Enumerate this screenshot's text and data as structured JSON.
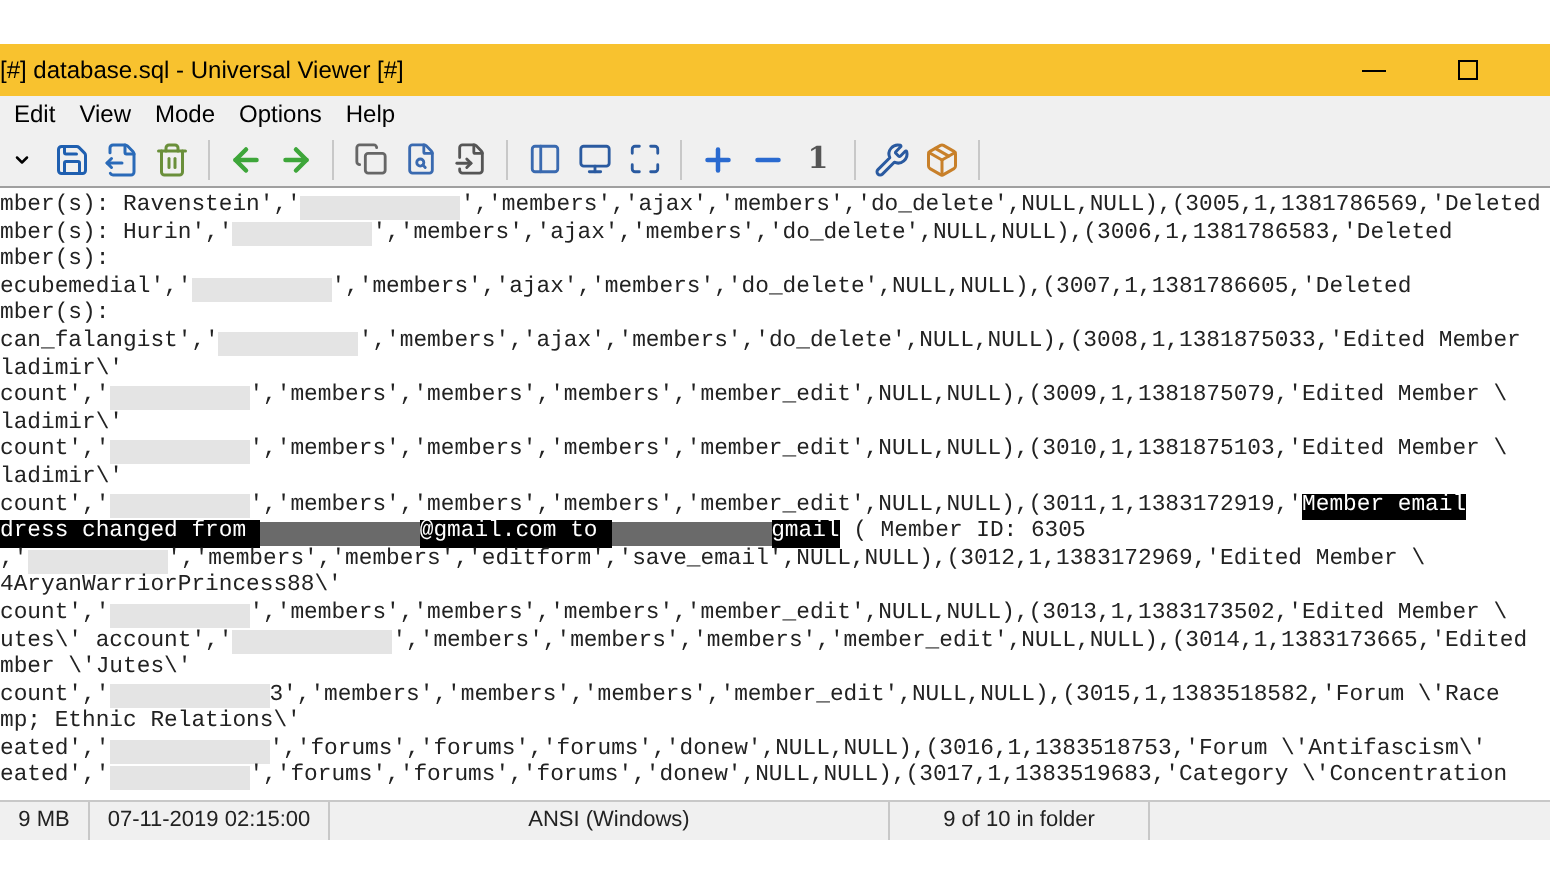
{
  "window": {
    "title": "[#] database.sql - Universal Viewer [#]"
  },
  "menu": [
    "Edit",
    "View",
    "Mode",
    "Options",
    "Help"
  ],
  "toolbar": {
    "actual_size_label": "1"
  },
  "lines": [
    [
      {
        "kind": "text",
        "text": "mber(s): Ravenstein','",
        "highlighted": false
      },
      {
        "kind": "redacted",
        "highlighted": false
      },
      {
        "kind": "text",
        "text": "','members','ajax','members','do_delete',NULL,NULL),(3005,1,1381786569,'Deleted",
        "highlighted": false
      }
    ],
    [
      {
        "kind": "text",
        "text": "mber(s): Hurin','",
        "highlighted": false
      },
      {
        "kind": "redacted",
        "highlighted": false
      },
      {
        "kind": "text",
        "text": "','members','ajax','members','do_delete',NULL,NULL),(3006,1,1381786583,'Deleted",
        "highlighted": false
      }
    ],
    [
      {
        "kind": "text",
        "text": "mber(s):",
        "highlighted": false
      }
    ],
    [
      {
        "kind": "text",
        "text": "ecubemedial','",
        "highlighted": false
      },
      {
        "kind": "redacted",
        "highlighted": false
      },
      {
        "kind": "text",
        "text": "','members','ajax','members','do_delete',NULL,NULL),(3007,1,1381786605,'Deleted",
        "highlighted": false
      }
    ],
    [
      {
        "kind": "text",
        "text": "mber(s):",
        "highlighted": false
      }
    ],
    [
      {
        "kind": "text",
        "text": "can_falangist','",
        "highlighted": false
      },
      {
        "kind": "redacted",
        "highlighted": false
      },
      {
        "kind": "text",
        "text": "','members','ajax','members','do_delete',NULL,NULL),(3008,1,1381875033,'Edited Member",
        "highlighted": false
      }
    ],
    [
      {
        "kind": "text",
        "text": "ladimir\\'",
        "highlighted": false
      }
    ],
    [
      {
        "kind": "text",
        "text": "count','",
        "highlighted": false
      },
      {
        "kind": "redacted",
        "highlighted": false
      },
      {
        "kind": "text",
        "text": "','members','members','members','member_edit',NULL,NULL),(3009,1,1381875079,'Edited Member \\",
        "highlighted": false
      }
    ],
    [
      {
        "kind": "text",
        "text": "ladimir\\'",
        "highlighted": false
      }
    ],
    [
      {
        "kind": "text",
        "text": "count','",
        "highlighted": false
      },
      {
        "kind": "redacted",
        "highlighted": false
      },
      {
        "kind": "text",
        "text": "','members','members','members','member_edit',NULL,NULL),(3010,1,1381875103,'Edited Member \\",
        "highlighted": false
      }
    ],
    [
      {
        "kind": "text",
        "text": "ladimir\\'",
        "highlighted": false
      }
    ],
    [
      {
        "kind": "text",
        "text": "count','",
        "highlighted": false
      },
      {
        "kind": "redacted",
        "highlighted": false
      },
      {
        "kind": "text",
        "text": "','members','members','members','member_edit',NULL,NULL),(3011,1,1383172919,'",
        "highlighted": false
      },
      {
        "kind": "text",
        "text": "Member email",
        "highlighted": true
      }
    ],
    [
      {
        "kind": "text",
        "text": "dress changed from ",
        "highlighted": true
      },
      {
        "kind": "redacted",
        "highlighted": true
      },
      {
        "kind": "text",
        "text": "@gmail.com to ",
        "highlighted": true
      },
      {
        "kind": "redacted",
        "highlighted": true
      },
      {
        "kind": "text",
        "text": "gmail",
        "highlighted": true
      },
      {
        "kind": "text",
        "text": " ( Member ID: 6305",
        "highlighted": false
      }
    ],
    [
      {
        "kind": "text",
        "text": ",'",
        "highlighted": false
      },
      {
        "kind": "redacted",
        "highlighted": false
      },
      {
        "kind": "text",
        "text": "','members','members','editform','save_email',NULL,NULL),(3012,1,1383172969,'Edited Member \\",
        "highlighted": false
      }
    ],
    [
      {
        "kind": "text",
        "text": "4AryanWarriorPrincess88\\'",
        "highlighted": false
      }
    ],
    [
      {
        "kind": "text",
        "text": "count','",
        "highlighted": false
      },
      {
        "kind": "redacted",
        "highlighted": false
      },
      {
        "kind": "text",
        "text": "','members','members','members','member_edit',NULL,NULL),(3013,1,1383173502,'Edited Member \\",
        "highlighted": false
      }
    ],
    [
      {
        "kind": "text",
        "text": "utes\\' account','",
        "highlighted": false
      },
      {
        "kind": "redacted",
        "highlighted": false
      },
      {
        "kind": "text",
        "text": "','members','members','members','member_edit',NULL,NULL),(3014,1,1383173665,'Edited",
        "highlighted": false
      }
    ],
    [
      {
        "kind": "text",
        "text": "mber \\'Jutes\\'",
        "highlighted": false
      }
    ],
    [
      {
        "kind": "text",
        "text": "count','",
        "highlighted": false
      },
      {
        "kind": "redacted",
        "highlighted": false
      },
      {
        "kind": "text",
        "text": "3','members','members','members','member_edit',NULL,NULL),(3015,1,1383518582,'Forum \\'Race",
        "highlighted": false
      }
    ],
    [
      {
        "kind": "text",
        "text": "mp; Ethnic Relations\\'",
        "highlighted": false
      }
    ],
    [
      {
        "kind": "text",
        "text": "eated','",
        "highlighted": false
      },
      {
        "kind": "redacted",
        "highlighted": false
      },
      {
        "kind": "text",
        "text": "','forums','forums','forums','donew',NULL,NULL),(3016,1,1383518753,'Forum \\'Antifascism\\'",
        "highlighted": false
      }
    ],
    [
      {
        "kind": "text",
        "text": "eated','",
        "highlighted": false
      },
      {
        "kind": "redacted",
        "highlighted": false
      },
      {
        "kind": "text",
        "text": "','forums','forums','forums','donew',NULL,NULL),(3017,1,1383519683,'Category \\'Concentration",
        "highlighted": false
      }
    ]
  ],
  "status_bar": [
    "9 MB",
    "07-11-2019 02:15:00",
    "ANSI (Windows)",
    "9 of 10 in folder"
  ]
}
